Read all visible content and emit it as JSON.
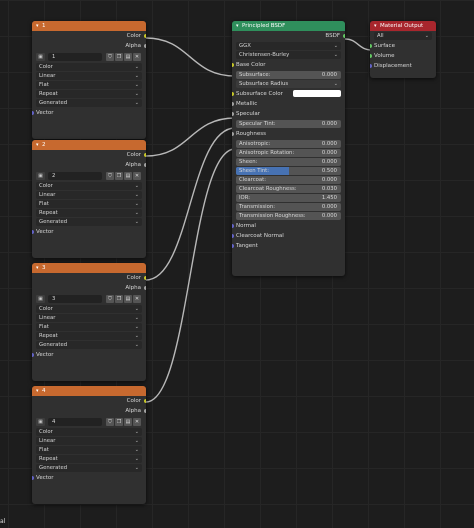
{
  "image_nodes": [
    {
      "header": "1",
      "outputs": [
        "Color",
        "Alpha"
      ],
      "image_num": "1",
      "settings": [
        "Color",
        "Linear",
        "Flat",
        "Repeat",
        "Generated"
      ],
      "input": "Vector"
    },
    {
      "header": "2",
      "outputs": [
        "Color",
        "Alpha"
      ],
      "image_num": "2",
      "settings": [
        "Color",
        "Linear",
        "Flat",
        "Repeat",
        "Generated"
      ],
      "input": "Vector"
    },
    {
      "header": "3",
      "outputs": [
        "Color",
        "Alpha"
      ],
      "image_num": "3",
      "settings": [
        "Color",
        "Linear",
        "Flat",
        "Repeat",
        "Generated"
      ],
      "input": "Vector"
    },
    {
      "header": "4",
      "outputs": [
        "Color",
        "Alpha"
      ],
      "image_num": "4",
      "settings": [
        "Color",
        "Linear",
        "Flat",
        "Repeat",
        "Generated"
      ],
      "input": "Vector"
    }
  ],
  "bsdf": {
    "header": "Principled BSDF",
    "output": "BSDF",
    "distribution": "GGX",
    "subsurface_method": "Christensen-Burley",
    "base_color": "Base Color",
    "subsurface": {
      "label": "Subsurface:",
      "value": "0.000"
    },
    "subsurface_radius": "Subsurface Radius",
    "subsurface_color": "Subsurface Color",
    "metallic": "Metallic",
    "specular": "Specular",
    "specular_tint": {
      "label": "Specular Tint:",
      "value": "0.000"
    },
    "roughness": "Roughness",
    "anisotropic": {
      "label": "Anisotropic:",
      "value": "0.000"
    },
    "anisotropic_rotation": {
      "label": "Anisotropic Rotation:",
      "value": "0.000"
    },
    "sheen": {
      "label": "Sheen:",
      "value": "0.000"
    },
    "sheen_tint": {
      "label": "Sheen Tint:",
      "value": "0.500",
      "fraction": 0.5
    },
    "clearcoat": {
      "label": "Clearcoat:",
      "value": "0.000"
    },
    "clearcoat_roughness": {
      "label": "Clearcoat Roughness:",
      "value": "0.030"
    },
    "ior": {
      "label": "IOR:",
      "value": "1.450"
    },
    "transmission": {
      "label": "Transmission:",
      "value": "0.000"
    },
    "transmission_roughness": {
      "label": "Transmission Roughness:",
      "value": "0.000"
    },
    "normal": "Normal",
    "clearcoat_normal": "Clearcoat Normal",
    "tangent": "Tangent"
  },
  "material_output": {
    "header": "Material Output",
    "target": "All",
    "inputs": [
      "Surface",
      "Volume",
      "Displacement"
    ]
  },
  "colors": {
    "image_header": "#c7692f",
    "bsdf_header": "#2f8f5c",
    "output_header": "#a8262d"
  },
  "status_fragment": "al"
}
